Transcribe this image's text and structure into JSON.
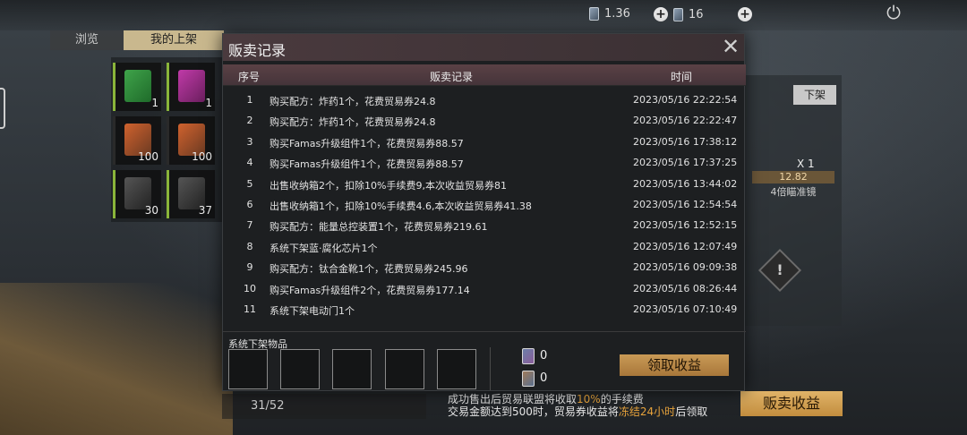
{
  "topbar": {
    "currency1_value": "1.36",
    "currency2_value": "16"
  },
  "background": {
    "tabs": [
      "浏览",
      "我的上架"
    ],
    "inventory_counts": [
      "1",
      "1",
      "100",
      "100",
      "30",
      "37"
    ],
    "slot_count": "31/52",
    "unlist_label": "下架",
    "item_qty": "X 1",
    "item_price": "12.82",
    "item_name": "4倍瞄准镜",
    "fee_note_line1_prefix": "成功售出后贸易联盟将收取",
    "fee_note_line1_highlight": "10%",
    "fee_note_line1_suffix": "的手续费",
    "fee_note_line2_prefix": "交易金额达到500时，贸易券收益将",
    "fee_note_line2_highlight": "冻结24小时",
    "fee_note_line2_suffix": "后领取",
    "sale_income_label": "贩卖收益"
  },
  "modal": {
    "title": "贩卖记录",
    "columns": {
      "no": "序号",
      "record": "贩卖记录",
      "time": "时间"
    },
    "rows": [
      {
        "no": "1",
        "desc": "购买配方：炸药1个，花费贸易券24.8",
        "time": "2023/05/16 22:22:54"
      },
      {
        "no": "2",
        "desc": "购买配方：炸药1个，花费贸易券24.8",
        "time": "2023/05/16 22:22:47"
      },
      {
        "no": "3",
        "desc": "购买Famas升级组件1个，花费贸易券88.57",
        "time": "2023/05/16 17:38:12"
      },
      {
        "no": "4",
        "desc": "购买Famas升级组件1个，花费贸易券88.57",
        "time": "2023/05/16 17:37:25"
      },
      {
        "no": "5",
        "desc": "出售收纳箱2个，扣除10%手续费9,本次收益贸易券81",
        "time": "2023/05/16 13:44:02"
      },
      {
        "no": "6",
        "desc": "出售收纳箱1个，扣除10%手续费4.6,本次收益贸易券41.38",
        "time": "2023/05/16 12:54:54"
      },
      {
        "no": "7",
        "desc": "购买配方：能量总控装置1个，花费贸易券219.61",
        "time": "2023/05/16 12:52:15"
      },
      {
        "no": "8",
        "desc": "系统下架蓝·腐化芯片1个",
        "time": "2023/05/16 12:07:49"
      },
      {
        "no": "9",
        "desc": "购买配方：钛合金靴1个，花费贸易券245.96",
        "time": "2023/05/16 09:09:38"
      },
      {
        "no": "10",
        "desc": "购买Famas升级组件2个，花费贸易券177.14",
        "time": "2023/05/16 08:26:44"
      },
      {
        "no": "11",
        "desc": "系统下架电动门1个",
        "time": "2023/05/16 07:10:49"
      }
    ],
    "returned_items_label": "系统下架物品",
    "ticket1_value": "0",
    "ticket2_value": "0",
    "claim_label": "领取收益"
  }
}
